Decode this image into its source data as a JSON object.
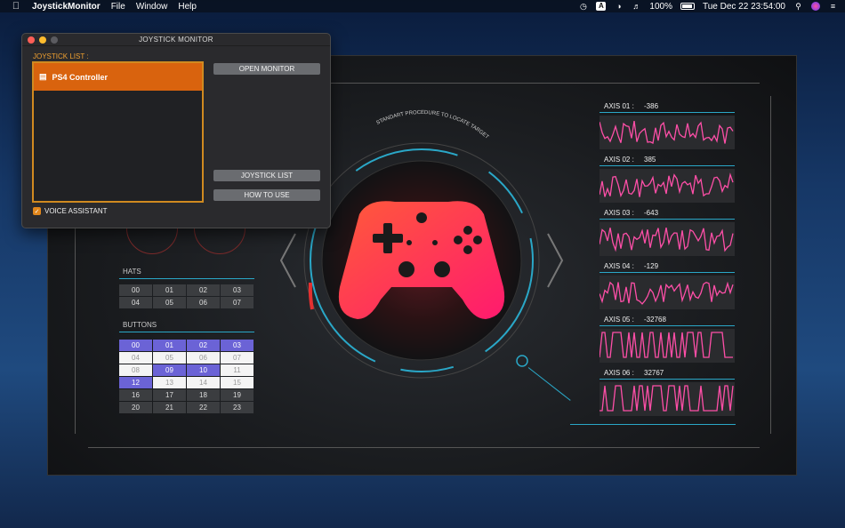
{
  "menubar": {
    "app_name": "JoystickMonitor",
    "menus": [
      "File",
      "Window",
      "Help"
    ],
    "battery": "100%",
    "datetime": "Tue Dec 22  23:54:00"
  },
  "panel": {
    "title": "JOYSTICK MONITOR",
    "list_label": "JOYSTICK LIST :",
    "devices": [
      "PS4 Controller"
    ],
    "open_monitor": "OPEN MONITOR",
    "joystick_list": "JOYSTICK LIST",
    "how_to_use": "HOW TO USE",
    "voice_assistant": "VOICE ASSISTANT",
    "voice_checked": true
  },
  "hud": {
    "hats_title": "HATS",
    "hats": [
      "00",
      "01",
      "02",
      "03",
      "04",
      "05",
      "06",
      "07"
    ],
    "buttons_title": "BUTTONS",
    "buttons": [
      {
        "l": "00",
        "s": "on"
      },
      {
        "l": "01",
        "s": "on"
      },
      {
        "l": "02",
        "s": "on"
      },
      {
        "l": "03",
        "s": "on"
      },
      {
        "l": "04",
        "s": "off"
      },
      {
        "l": "05",
        "s": "off"
      },
      {
        "l": "06",
        "s": "off"
      },
      {
        "l": "07",
        "s": "off"
      },
      {
        "l": "08",
        "s": "off"
      },
      {
        "l": "09",
        "s": "on"
      },
      {
        "l": "10",
        "s": "on"
      },
      {
        "l": "11",
        "s": "off"
      },
      {
        "l": "12",
        "s": "on"
      },
      {
        "l": "13",
        "s": "off"
      },
      {
        "l": "14",
        "s": "off"
      },
      {
        "l": "15",
        "s": "off"
      },
      {
        "l": "16",
        "s": "dim"
      },
      {
        "l": "17",
        "s": "dim"
      },
      {
        "l": "18",
        "s": "dim"
      },
      {
        "l": "19",
        "s": "dim"
      },
      {
        "l": "20",
        "s": "dim"
      },
      {
        "l": "21",
        "s": "dim"
      },
      {
        "l": "22",
        "s": "dim"
      },
      {
        "l": "23",
        "s": "dim"
      }
    ],
    "arc_text": "STANDART PROCEDURE TO LOCATE TARGET",
    "axes": [
      {
        "label": "AXIS  01 :",
        "value": "-386"
      },
      {
        "label": "AXIS  02 :",
        "value": "385"
      },
      {
        "label": "AXIS  03 :",
        "value": "-643"
      },
      {
        "label": "AXIS  04 :",
        "value": "-129"
      },
      {
        "label": "AXIS  05 :",
        "value": "-32768"
      },
      {
        "label": "AXIS  06 :",
        "value": "32767"
      }
    ],
    "colors": {
      "accent": "#2aa7c7",
      "controller": "#ff2a5c",
      "axis": "#ff4fa8"
    }
  }
}
